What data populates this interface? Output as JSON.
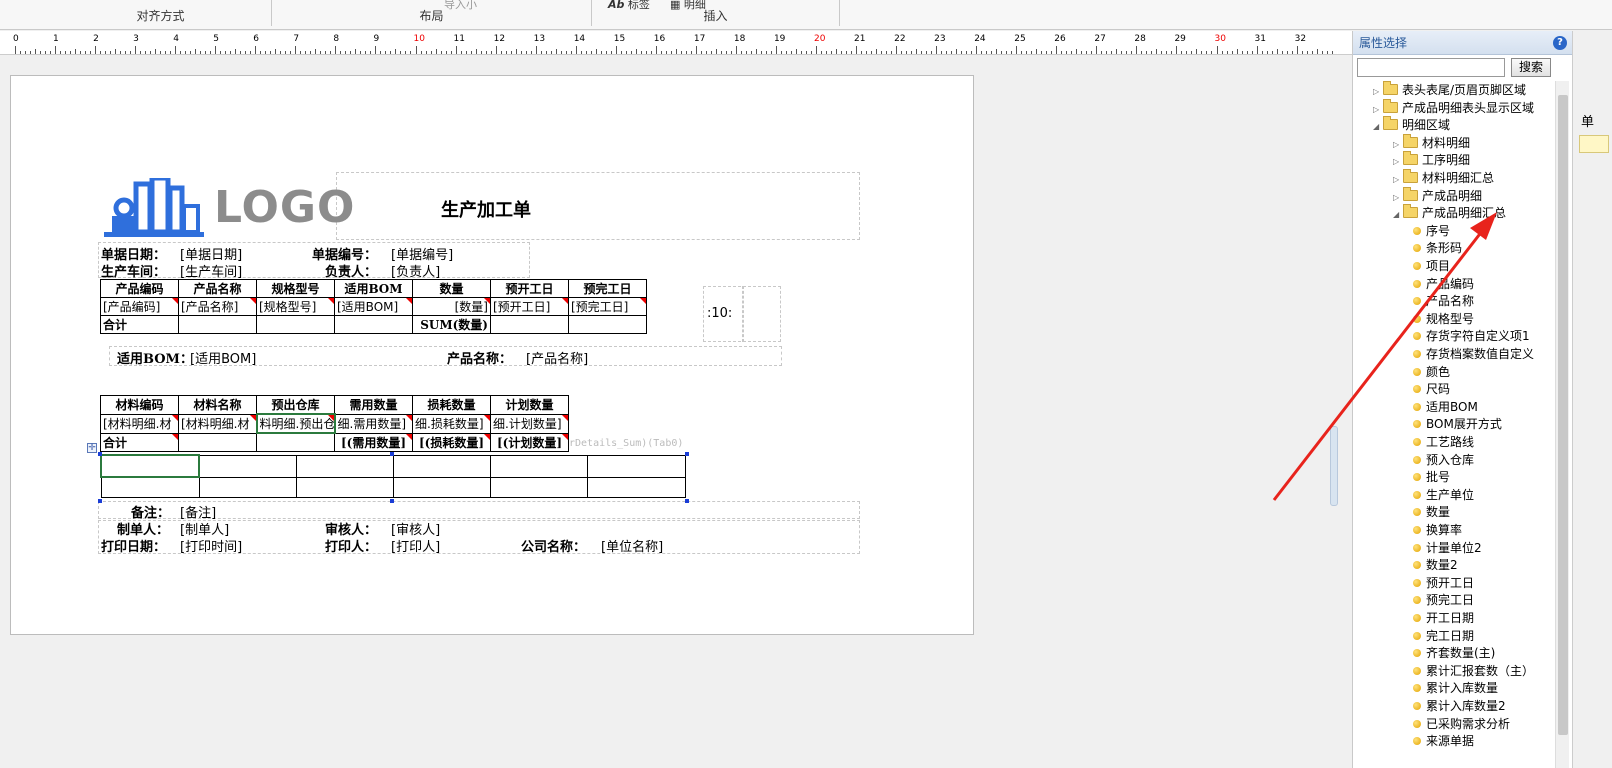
{
  "ribbon": {
    "groups": [
      "对齐方式",
      "布局",
      "插入"
    ],
    "partial_items": [
      "导入小",
      "标签",
      "明细"
    ]
  },
  "ruler": {
    "numbers": [
      "0",
      "1",
      "2",
      "3",
      "4",
      "5",
      "6",
      "7",
      "8",
      "9",
      "10",
      "11",
      "12",
      "13",
      "14",
      "15",
      "16",
      "17",
      "18",
      "19",
      "20",
      "21",
      "22",
      "23",
      "24",
      "25",
      "26",
      "27",
      "28",
      "29",
      "30",
      "31",
      "32"
    ],
    "red_numbers": [
      "10",
      "20",
      "30"
    ]
  },
  "report": {
    "logo_text": "LOGO",
    "title": "生产加工单",
    "doc_date_label": "单据日期：",
    "doc_date_value": "[单据日期]",
    "doc_no_label": "单据编号：",
    "doc_no_value": "[单据编号]",
    "workshop_label": "生产车间：",
    "workshop_value": "[生产车间]",
    "owner_label": "负责人：",
    "owner_value": "[负责人]",
    "product_table": {
      "headers": [
        "产品编码",
        "产品名称",
        "规格型号",
        "适用BOM",
        "数量",
        "预开工日",
        "预完工日"
      ],
      "row": [
        "[产品编码]",
        "[产品名称]",
        "[规格型号]",
        "[适用BOM]",
        "[数量]",
        "[预开工日]",
        "[预完工日]"
      ],
      "total": [
        "合计",
        "",
        "",
        "",
        "SUM(数量)",
        "",
        ""
      ]
    },
    "side_box_text": ":10:",
    "bom_label": "适用BOM：",
    "bom_value": "[适用BOM]",
    "product_name_label": "产品名称：",
    "product_name_value": "[产品名称]",
    "material_table": {
      "headers": [
        "材料编码",
        "材料名称",
        "预出仓库",
        "需用数量",
        "损耗数量",
        "计划数量"
      ],
      "row": [
        "[材料明细.材",
        "[材料明细.材",
        "料明细.预出仓",
        "细.需用数量]",
        "细.损耗数量]",
        "细.计划数量]"
      ],
      "total": [
        "合计",
        "",
        "",
        "[(需用数量]",
        "[(损耗数量]",
        "[(计划数量]"
      ]
    },
    "faint_text": "rDetails_Sum)(Tab0)",
    "remark_label": "备注：",
    "remark_value": "[备注]",
    "maker_label": "制单人：",
    "maker_value": "[制单人]",
    "auditor_label": "审核人：",
    "auditor_value": "[审核人]",
    "print_date_label": "打印日期：",
    "print_date_value": "[打印时间]",
    "printer_label": "打印人：",
    "printer_value": "[打印人]",
    "company_label": "公司名称：",
    "company_value": "[单位名称]"
  },
  "panel": {
    "title": "属性选择",
    "search_button": "搜索",
    "tree": [
      {
        "label": "表头表尾/页眉页脚区域",
        "level": 0,
        "type": "folder",
        "expanded": false
      },
      {
        "label": "产成品明细表头显示区域",
        "level": 0,
        "type": "folder",
        "expanded": false
      },
      {
        "label": "明细区域",
        "level": 0,
        "type": "folder",
        "expanded": true
      },
      {
        "label": "材料明细",
        "level": 1,
        "type": "folder",
        "expanded": false
      },
      {
        "label": "工序明细",
        "level": 1,
        "type": "folder",
        "expanded": false
      },
      {
        "label": "材料明细汇总",
        "level": 1,
        "type": "folder",
        "expanded": false
      },
      {
        "label": "产成品明细",
        "level": 1,
        "type": "folder",
        "expanded": false
      },
      {
        "label": "产成品明细汇总",
        "level": 1,
        "type": "folder",
        "expanded": true
      },
      {
        "label": "序号",
        "level": 2,
        "type": "field"
      },
      {
        "label": "条形码",
        "level": 2,
        "type": "field"
      },
      {
        "label": "项目",
        "level": 2,
        "type": "field"
      },
      {
        "label": "产品编码",
        "level": 2,
        "type": "field"
      },
      {
        "label": "产品名称",
        "level": 2,
        "type": "field"
      },
      {
        "label": "规格型号",
        "level": 2,
        "type": "field"
      },
      {
        "label": "存货字符自定义项1",
        "level": 2,
        "type": "field"
      },
      {
        "label": "存货档案数值自定义",
        "level": 2,
        "type": "field"
      },
      {
        "label": "颜色",
        "level": 2,
        "type": "field"
      },
      {
        "label": "尺码",
        "level": 2,
        "type": "field"
      },
      {
        "label": "适用BOM",
        "level": 2,
        "type": "field"
      },
      {
        "label": "BOM展开方式",
        "level": 2,
        "type": "field"
      },
      {
        "label": "工艺路线",
        "level": 2,
        "type": "field"
      },
      {
        "label": "预入仓库",
        "level": 2,
        "type": "field"
      },
      {
        "label": "批号",
        "level": 2,
        "type": "field"
      },
      {
        "label": "生产单位",
        "level": 2,
        "type": "field"
      },
      {
        "label": "数量",
        "level": 2,
        "type": "field"
      },
      {
        "label": "换算率",
        "level": 2,
        "type": "field"
      },
      {
        "label": "计量单位2",
        "level": 2,
        "type": "field"
      },
      {
        "label": "数量2",
        "level": 2,
        "type": "field"
      },
      {
        "label": "预开工日",
        "level": 2,
        "type": "field"
      },
      {
        "label": "预完工日",
        "level": 2,
        "type": "field"
      },
      {
        "label": "开工日期",
        "level": 2,
        "type": "field"
      },
      {
        "label": "完工日期",
        "level": 2,
        "type": "field"
      },
      {
        "label": "齐套数量(主)",
        "level": 2,
        "type": "field"
      },
      {
        "label": "累计汇报套数（主）",
        "level": 2,
        "type": "field"
      },
      {
        "label": "累计入库数量",
        "level": 2,
        "type": "field"
      },
      {
        "label": "累计入库数量2",
        "level": 2,
        "type": "field"
      },
      {
        "label": "已采购需求分析",
        "level": 2,
        "type": "field"
      },
      {
        "label": "来源单据",
        "level": 2,
        "type": "field"
      }
    ]
  },
  "right_strip_text": "单",
  "colors": {
    "arrow": "#e8231c",
    "accent": "#2a5a9a",
    "field_dot": "#e3a300"
  }
}
